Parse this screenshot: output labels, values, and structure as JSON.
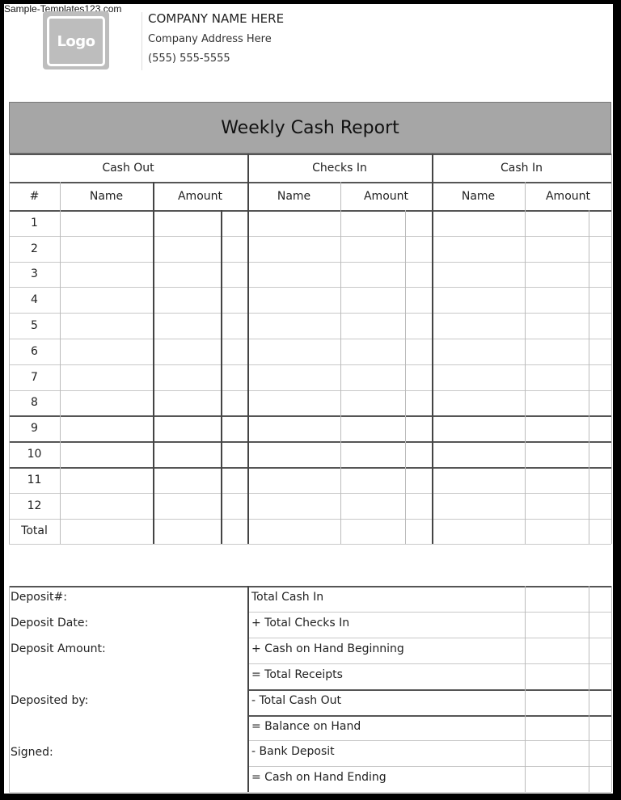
{
  "watermark": "Sample-Templates123.com",
  "header": {
    "logo_label": "Logo",
    "company_name": "COMPANY NAME HERE",
    "company_address": "Company Address Here",
    "company_phone": "(555) 555-5555"
  },
  "report": {
    "title": "Weekly Cash Report",
    "groups": [
      "Cash Out",
      "Checks In",
      "Cash In"
    ],
    "columns": [
      "#",
      "Name",
      "Amount",
      "Name",
      "Amount",
      "Name",
      "Amount"
    ],
    "rows": [
      "1",
      "2",
      "3",
      "4",
      "5",
      "6",
      "7",
      "8",
      "9",
      "10",
      "11",
      "12",
      "Total"
    ]
  },
  "deposit": {
    "fields": [
      "Deposit#:",
      "Deposit Date:",
      "Deposit Amount:",
      "Deposited by:",
      "Signed:"
    ]
  },
  "summary": {
    "lines": [
      "Total Cash In",
      "+ Total Checks In",
      "+ Cash on Hand Beginning",
      "= Total Receipts",
      "- Total Cash Out",
      "= Balance on Hand",
      "- Bank Deposit",
      "= Cash on Hand Ending"
    ]
  }
}
